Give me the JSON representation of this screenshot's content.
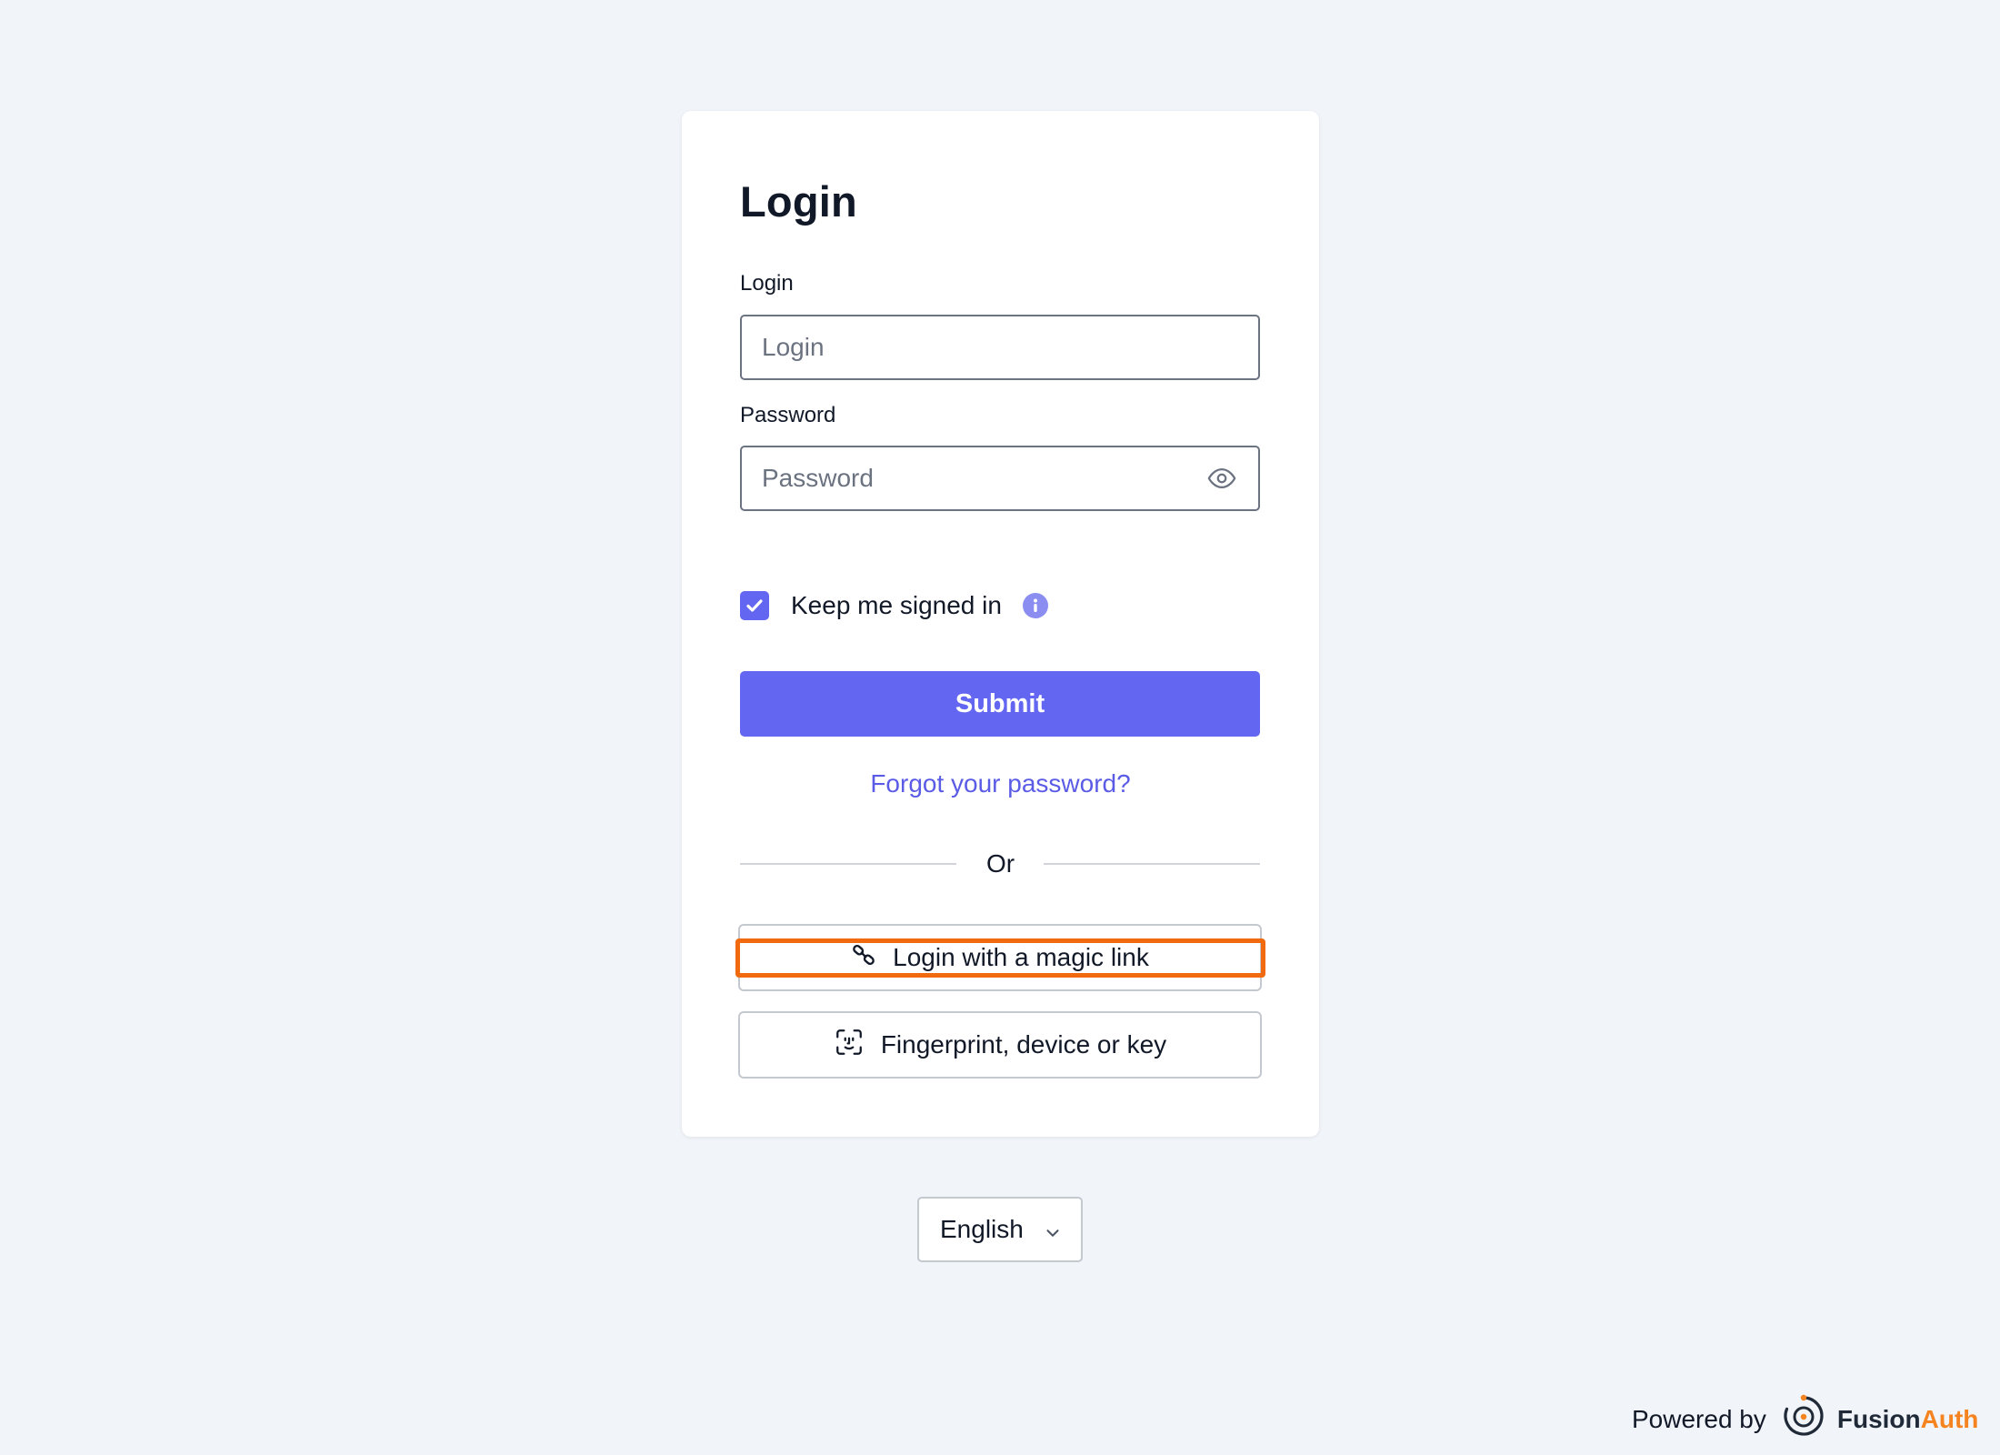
{
  "form": {
    "title": "Login",
    "login_label": "Login",
    "login_placeholder": "Login",
    "login_value": "",
    "password_label": "Password",
    "password_placeholder": "Password",
    "password_value": "",
    "keep_signed_in_label": "Keep me signed in",
    "keep_signed_in_checked": true,
    "submit_label": "Submit",
    "forgot_password_label": "Forgot your password?",
    "divider_text": "Or",
    "magic_link_label": "Login with a magic link",
    "passkey_label": "Fingerprint, device or key"
  },
  "language_select": {
    "selected": "English"
  },
  "footer": {
    "powered_by": "Powered by",
    "brand_part1": "Fusion",
    "brand_part2": "Auth"
  },
  "icons": {
    "password_toggle": "eye-icon",
    "info": "info-icon",
    "magic_link": "link-icon",
    "passkey": "face-id-icon",
    "language": "chevron-down-icon",
    "brand": "fusionauth-logo"
  },
  "colors": {
    "page_background": "#f1f4f8",
    "primary": "#6366f1",
    "link": "#5b5ce6",
    "highlight": "#f26a10",
    "brand_orange": "#f58320"
  }
}
